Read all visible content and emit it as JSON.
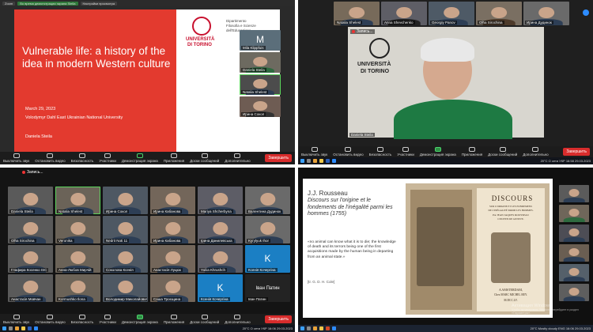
{
  "q1": {
    "tabs": [
      "Zoom",
      "Во время демонстрации экрана Stella",
      "Настройки просмотра"
    ],
    "slide": {
      "title": "Vulnerable life: a history of the idea in modern Western culture",
      "date": "March 29, 2023",
      "institution": "Volodymyr Dahl East Ukrainian National University",
      "speaker": "Daniela Steila",
      "logo_top": "UNIVERSITÀ",
      "logo_bottom": "DI TORINO",
      "dept": "Dipartimento Filosofia e Scienze dell'Educazione"
    },
    "side_tiles": [
      {
        "name": "Mila Klippfuis",
        "letter": "M"
      },
      {
        "name": "Daniela Steila"
      },
      {
        "name": "Natalia Shelest"
      },
      {
        "name": "Ирина Сокол"
      }
    ],
    "toolbar": [
      "Выключить звук",
      "Остановить видео",
      "Безопасность",
      "Участники",
      "Демонстрация экрана",
      "Приложения",
      "Доски сообщений",
      "Дополнительно"
    ],
    "participants_count": "27",
    "end_label": "Завершить"
  },
  "q2": {
    "top_names": [
      "Natalia Shelest",
      "Anna Shevchenko",
      "Georgiy Panov",
      "Olha Sirochina",
      "Ирина Дудинок"
    ],
    "recording": "Запись...",
    "main_name": "Daniela Steila",
    "logo_top": "UNIVERSITÀ",
    "logo_bottom": "DI TORINO",
    "toolbar": [
      "Выключить звук",
      "Остановить видео",
      "Безопасность",
      "Участники",
      "Демонстрация экрана",
      "Приложения",
      "Доски сообщений",
      "Дополнительно"
    ],
    "participants_count": "27",
    "end_label": "Завершить",
    "tray": {
      "weather": "20°C",
      "lang": "УКР",
      "time": "16:58",
      "date": "29.03.2023",
      "status": "О сети"
    }
  },
  "q3": {
    "recording": "Запись...",
    "tiles": [
      "Daniela Steila",
      "Natalia Shelest",
      "Ирина Сокол",
      "Ирина Кабанова",
      "Mariya Shcherbyna",
      "Валентина Дудинок",
      "Olha Sirochina",
      "Veronika",
      "Nedrit Noti 11",
      "Ирина Кабанова",
      "Ірина Данилевська",
      "Kyrylyuk Ihor",
      "Глафира Косенко ISC",
      "Анна-Любов Мирчій",
      "Соколова Ксенія",
      "Анастасія Луцюк",
      "Yuliia Khrushch",
      "Ксенія Кочергіна",
      "Анастасія Мовчан",
      "Kormushko Ilona",
      "Володимир Миколайович",
      "Саша Троєщина",
      "Ксенія Кочергіна",
      "Іван Патин"
    ],
    "k_tiles": {
      "k1": "K",
      "k2": "K"
    },
    "ivan_label": "Іван Патин",
    "toolbar": [
      "Выключить звук",
      "Остановить видео",
      "Безопасность",
      "Участники",
      "Демонстрация экрана",
      "Приложения",
      "Доски сообщений",
      "Дополнительно"
    ],
    "participants_count": "27",
    "end_label": "Завершить",
    "tray": {
      "weather": "20°C",
      "lang": "УКР",
      "time": "16:06",
      "date": "29.03.2023",
      "status": "О сети"
    }
  },
  "q4": {
    "slide": {
      "author": "J.J. Rousseau",
      "work": "Discours sur l'origine et le fondements de l'inégalité parmi les hommes (1755)",
      "quote": "«no animal can know what it is to die; the knowledge of death and its terrors being one of the first acquisitions made by the human being in departing from an animal state.»",
      "translator": "[tr. G. D. H. Cole]",
      "book_title": "DISCOURS",
      "book_lines": [
        "SUR L'ORIGINE ET LES FONDEMENS",
        "DE L'INÉGALITÉ PARMI LES HOMMES.",
        "Par JEAN JAQUES ROUSSEAU",
        "CITOYEN DE GENEVE.",
        "A AMSTERDAM,",
        "Chez MARC MICHEL REY.",
        "M.DCC.LV."
      ]
    },
    "side_names": [
      "",
      "",
      "",
      "",
      "",
      ""
    ],
    "activate": "Активация Windows",
    "activate_sub": "Чтобы активировать Windows, перейдите в раздел «Параметры».",
    "tray": {
      "weather": "20°C Mostly cloudy",
      "lang": "ENG",
      "time": "16:06",
      "date": "29.03.2023"
    }
  }
}
